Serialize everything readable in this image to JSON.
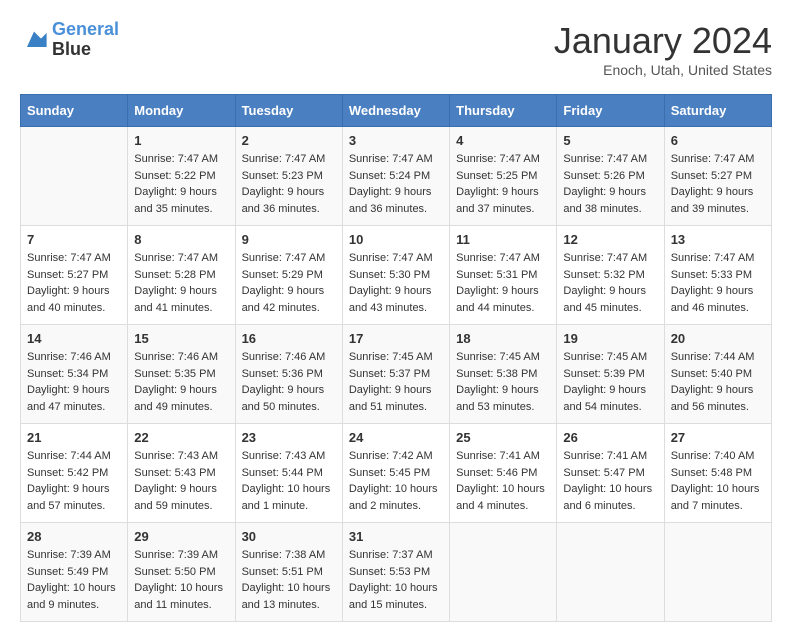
{
  "logo": {
    "line1": "General",
    "line2": "Blue"
  },
  "title": "January 2024",
  "subtitle": "Enoch, Utah, United States",
  "days_of_week": [
    "Sunday",
    "Monday",
    "Tuesday",
    "Wednesday",
    "Thursday",
    "Friday",
    "Saturday"
  ],
  "weeks": [
    [
      {
        "day": "",
        "sunrise": "",
        "sunset": "",
        "daylight": ""
      },
      {
        "day": "1",
        "sunrise": "Sunrise: 7:47 AM",
        "sunset": "Sunset: 5:22 PM",
        "daylight": "Daylight: 9 hours and 35 minutes."
      },
      {
        "day": "2",
        "sunrise": "Sunrise: 7:47 AM",
        "sunset": "Sunset: 5:23 PM",
        "daylight": "Daylight: 9 hours and 36 minutes."
      },
      {
        "day": "3",
        "sunrise": "Sunrise: 7:47 AM",
        "sunset": "Sunset: 5:24 PM",
        "daylight": "Daylight: 9 hours and 36 minutes."
      },
      {
        "day": "4",
        "sunrise": "Sunrise: 7:47 AM",
        "sunset": "Sunset: 5:25 PM",
        "daylight": "Daylight: 9 hours and 37 minutes."
      },
      {
        "day": "5",
        "sunrise": "Sunrise: 7:47 AM",
        "sunset": "Sunset: 5:26 PM",
        "daylight": "Daylight: 9 hours and 38 minutes."
      },
      {
        "day": "6",
        "sunrise": "Sunrise: 7:47 AM",
        "sunset": "Sunset: 5:27 PM",
        "daylight": "Daylight: 9 hours and 39 minutes."
      }
    ],
    [
      {
        "day": "7",
        "sunrise": "Sunrise: 7:47 AM",
        "sunset": "Sunset: 5:27 PM",
        "daylight": "Daylight: 9 hours and 40 minutes."
      },
      {
        "day": "8",
        "sunrise": "Sunrise: 7:47 AM",
        "sunset": "Sunset: 5:28 PM",
        "daylight": "Daylight: 9 hours and 41 minutes."
      },
      {
        "day": "9",
        "sunrise": "Sunrise: 7:47 AM",
        "sunset": "Sunset: 5:29 PM",
        "daylight": "Daylight: 9 hours and 42 minutes."
      },
      {
        "day": "10",
        "sunrise": "Sunrise: 7:47 AM",
        "sunset": "Sunset: 5:30 PM",
        "daylight": "Daylight: 9 hours and 43 minutes."
      },
      {
        "day": "11",
        "sunrise": "Sunrise: 7:47 AM",
        "sunset": "Sunset: 5:31 PM",
        "daylight": "Daylight: 9 hours and 44 minutes."
      },
      {
        "day": "12",
        "sunrise": "Sunrise: 7:47 AM",
        "sunset": "Sunset: 5:32 PM",
        "daylight": "Daylight: 9 hours and 45 minutes."
      },
      {
        "day": "13",
        "sunrise": "Sunrise: 7:47 AM",
        "sunset": "Sunset: 5:33 PM",
        "daylight": "Daylight: 9 hours and 46 minutes."
      }
    ],
    [
      {
        "day": "14",
        "sunrise": "Sunrise: 7:46 AM",
        "sunset": "Sunset: 5:34 PM",
        "daylight": "Daylight: 9 hours and 47 minutes."
      },
      {
        "day": "15",
        "sunrise": "Sunrise: 7:46 AM",
        "sunset": "Sunset: 5:35 PM",
        "daylight": "Daylight: 9 hours and 49 minutes."
      },
      {
        "day": "16",
        "sunrise": "Sunrise: 7:46 AM",
        "sunset": "Sunset: 5:36 PM",
        "daylight": "Daylight: 9 hours and 50 minutes."
      },
      {
        "day": "17",
        "sunrise": "Sunrise: 7:45 AM",
        "sunset": "Sunset: 5:37 PM",
        "daylight": "Daylight: 9 hours and 51 minutes."
      },
      {
        "day": "18",
        "sunrise": "Sunrise: 7:45 AM",
        "sunset": "Sunset: 5:38 PM",
        "daylight": "Daylight: 9 hours and 53 minutes."
      },
      {
        "day": "19",
        "sunrise": "Sunrise: 7:45 AM",
        "sunset": "Sunset: 5:39 PM",
        "daylight": "Daylight: 9 hours and 54 minutes."
      },
      {
        "day": "20",
        "sunrise": "Sunrise: 7:44 AM",
        "sunset": "Sunset: 5:40 PM",
        "daylight": "Daylight: 9 hours and 56 minutes."
      }
    ],
    [
      {
        "day": "21",
        "sunrise": "Sunrise: 7:44 AM",
        "sunset": "Sunset: 5:42 PM",
        "daylight": "Daylight: 9 hours and 57 minutes."
      },
      {
        "day": "22",
        "sunrise": "Sunrise: 7:43 AM",
        "sunset": "Sunset: 5:43 PM",
        "daylight": "Daylight: 9 hours and 59 minutes."
      },
      {
        "day": "23",
        "sunrise": "Sunrise: 7:43 AM",
        "sunset": "Sunset: 5:44 PM",
        "daylight": "Daylight: 10 hours and 1 minute."
      },
      {
        "day": "24",
        "sunrise": "Sunrise: 7:42 AM",
        "sunset": "Sunset: 5:45 PM",
        "daylight": "Daylight: 10 hours and 2 minutes."
      },
      {
        "day": "25",
        "sunrise": "Sunrise: 7:41 AM",
        "sunset": "Sunset: 5:46 PM",
        "daylight": "Daylight: 10 hours and 4 minutes."
      },
      {
        "day": "26",
        "sunrise": "Sunrise: 7:41 AM",
        "sunset": "Sunset: 5:47 PM",
        "daylight": "Daylight: 10 hours and 6 minutes."
      },
      {
        "day": "27",
        "sunrise": "Sunrise: 7:40 AM",
        "sunset": "Sunset: 5:48 PM",
        "daylight": "Daylight: 10 hours and 7 minutes."
      }
    ],
    [
      {
        "day": "28",
        "sunrise": "Sunrise: 7:39 AM",
        "sunset": "Sunset: 5:49 PM",
        "daylight": "Daylight: 10 hours and 9 minutes."
      },
      {
        "day": "29",
        "sunrise": "Sunrise: 7:39 AM",
        "sunset": "Sunset: 5:50 PM",
        "daylight": "Daylight: 10 hours and 11 minutes."
      },
      {
        "day": "30",
        "sunrise": "Sunrise: 7:38 AM",
        "sunset": "Sunset: 5:51 PM",
        "daylight": "Daylight: 10 hours and 13 minutes."
      },
      {
        "day": "31",
        "sunrise": "Sunrise: 7:37 AM",
        "sunset": "Sunset: 5:53 PM",
        "daylight": "Daylight: 10 hours and 15 minutes."
      },
      {
        "day": "",
        "sunrise": "",
        "sunset": "",
        "daylight": ""
      },
      {
        "day": "",
        "sunrise": "",
        "sunset": "",
        "daylight": ""
      },
      {
        "day": "",
        "sunrise": "",
        "sunset": "",
        "daylight": ""
      }
    ]
  ]
}
